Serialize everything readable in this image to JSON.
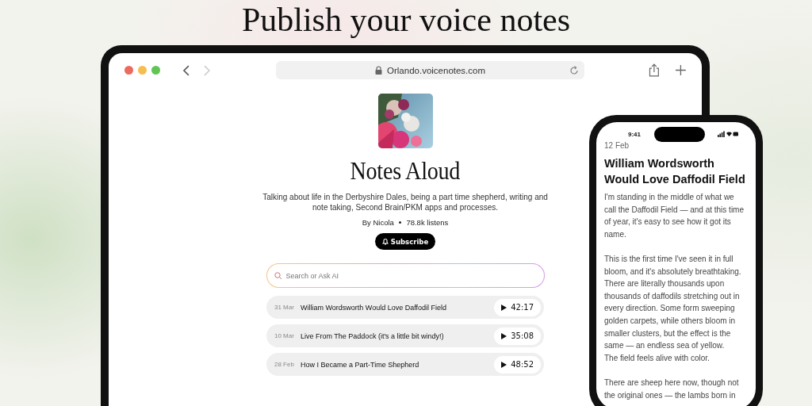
{
  "headline": "Publish your voice notes",
  "browser": {
    "url": "Orlando.voicenotes.com"
  },
  "profile": {
    "title": "Notes Aloud",
    "description": "Talking about life in the Derbyshire Dales, being a part time shepherd, writing and note taking, Second Brain/PKM apps and processes.",
    "author": "By Nicola",
    "listens": "78.8k listens",
    "subscribe": "Subscribe"
  },
  "search": {
    "placeholder": "Search or Ask AI"
  },
  "episodes": [
    {
      "date": "31 Mar",
      "title": "William Wordsworth Would Love Daffodil Field",
      "duration": "42:17"
    },
    {
      "date": "10 Mar",
      "title": "Live From The Paddock (it's a little bit windy!)",
      "duration": "35:08"
    },
    {
      "date": "28 Feb",
      "title": "How I Became a Part-Time Shepherd",
      "duration": "48:52"
    }
  ],
  "phone": {
    "time": "9:41",
    "date": "12 Feb",
    "title": "William Wordsworth Would Love Daffodil Field",
    "paragraphs": [
      [
        "I'm standing in the middle of what we call the Daffodil Field — and at this time of year, it's easy to see how it got its name."
      ],
      [
        "This is the first time I've seen it in full bloom, and it's absolutely breathtaking. There are literally thousands upon thousands of daffodils stretching out in every direction. Some form sweeping golden carpets, while others bloom in smaller clusters, but the effect is the same — an endless sea of yellow.",
        "The field feels alive with color."
      ],
      [
        "There are sheep here now, though not the original ones — the lambs born in"
      ]
    ]
  }
}
